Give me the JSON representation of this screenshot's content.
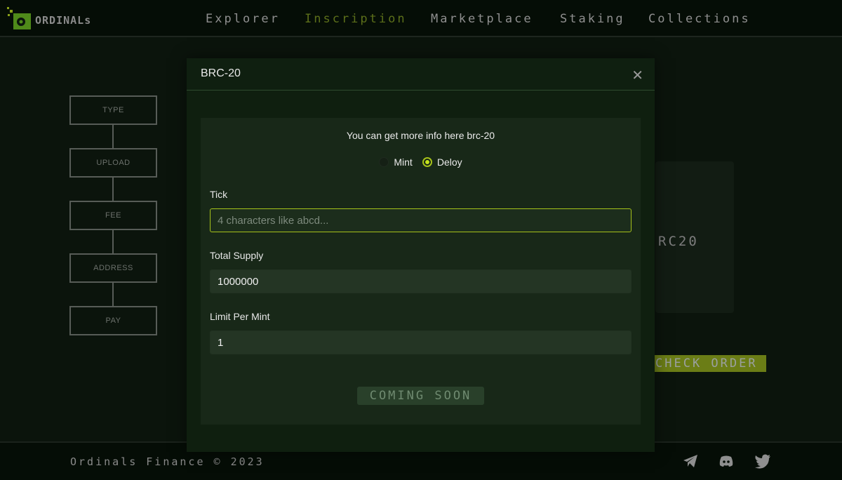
{
  "nav": {
    "brand": "ORDINALs",
    "items": [
      "Explorer",
      "Inscription",
      "Marketplace",
      "Staking",
      "Collections"
    ],
    "active": "Inscription"
  },
  "steps": [
    "TYPE",
    "UPLOAD",
    "FEE",
    "ADDRESS",
    "PAY"
  ],
  "background": {
    "card_text": "RC20",
    "check_order": "CHECK ORDER"
  },
  "modal": {
    "title": "BRC-20",
    "info": "You can get more info here brc-20",
    "radios": [
      {
        "label": "Mint",
        "checked": false
      },
      {
        "label": "Deloy",
        "checked": true
      }
    ],
    "tick": {
      "label": "Tick",
      "value": "",
      "placeholder": "4 characters like abcd..."
    },
    "supply": {
      "label": "Total Supply",
      "value": "1000000"
    },
    "limit": {
      "label": "Limit Per Mint",
      "value": "1"
    },
    "button": "COMING SOON"
  },
  "footer": {
    "copyright": "Ordinals Finance © 2023",
    "social": [
      "telegram-icon",
      "discord-icon",
      "twitter-icon"
    ]
  },
  "colors": {
    "accent": "#a6c21a",
    "background": "#0b140c"
  }
}
